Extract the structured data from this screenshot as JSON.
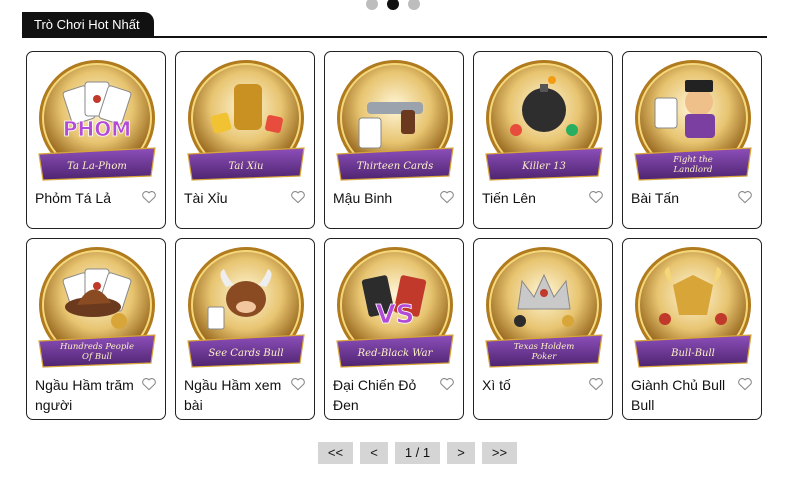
{
  "section": {
    "title": "Trò Chơi Hot Nhất"
  },
  "carousel": {
    "dots": 3,
    "active_index": 1
  },
  "games": [
    {
      "name": "Phỏm Tá Lả",
      "badge": "Ta La-Phom",
      "logo": "PHOM",
      "theme": "cards",
      "accent": "#7a3fa0"
    },
    {
      "name": "Tài Xỉu",
      "badge": "Tai Xiu",
      "logo": "",
      "theme": "dice",
      "accent": "#7a3fa0"
    },
    {
      "name": "Mậu Binh",
      "badge": "Thirteen Cards",
      "logo": "",
      "theme": "gun",
      "accent": "#7a3fa0"
    },
    {
      "name": "Tiến Lên",
      "badge": "Killer 13",
      "logo": "",
      "theme": "bomb",
      "accent": "#7a3fa0"
    },
    {
      "name": "Bài Tấn",
      "badge": "Fight the Landlord",
      "logo": "",
      "theme": "landlord",
      "accent": "#7a3fa0"
    },
    {
      "name": "Ngầu Hầm trăm người",
      "badge": "Hundreds People Of Bull",
      "logo": "",
      "theme": "hat",
      "accent": "#7a3fa0"
    },
    {
      "name": "Ngầu Hầm xem bài",
      "badge": "See Cards Bull",
      "logo": "",
      "theme": "bull",
      "accent": "#7a3fa0"
    },
    {
      "name": "Đại Chiến Đỏ Đen",
      "badge": "Red-Black War",
      "logo": "VS",
      "theme": "vs",
      "accent": "#7a3fa0"
    },
    {
      "name": "Xì tố",
      "badge": "Texas Holdem Poker",
      "logo": "",
      "theme": "crown",
      "accent": "#7a3fa0"
    },
    {
      "name": "Giành Chủ Bull Bull",
      "badge": "Bull-Bull",
      "logo": "",
      "theme": "bullhead",
      "accent": "#7a3fa0"
    }
  ],
  "pagination": {
    "first": "<<",
    "prev": "<",
    "info": "1 / 1",
    "next": ">",
    "last": ">>"
  },
  "icons": {
    "favorite": "heart-outline-icon"
  },
  "colors": {
    "gold": "#d8a638",
    "ribbon": "#6f3a96",
    "tab_bg": "#111111",
    "pager_bg": "#d5d5d5"
  }
}
